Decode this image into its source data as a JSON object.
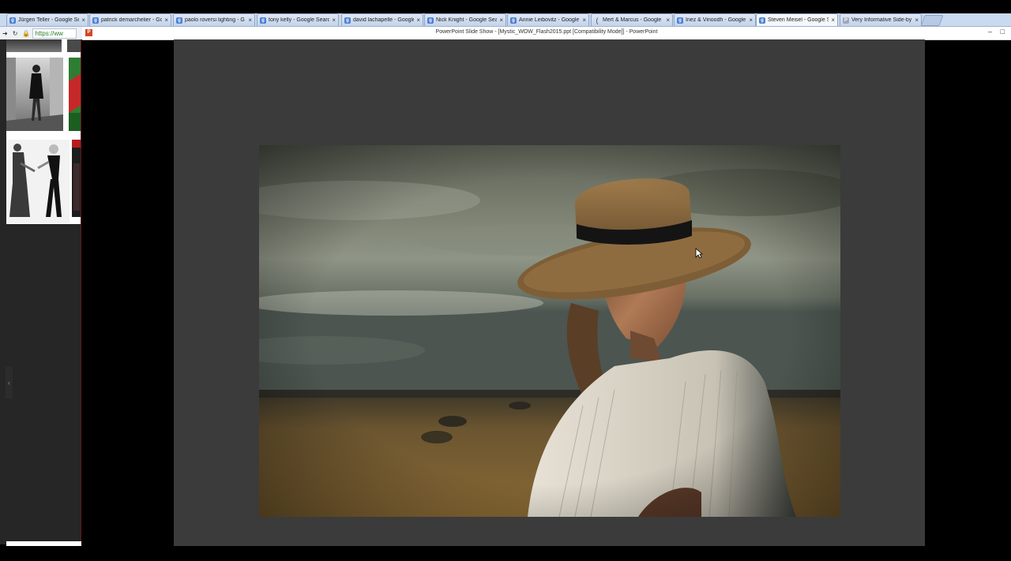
{
  "browser": {
    "tabs": [
      {
        "title": "Jürgen Teller - Google Se",
        "icon": "google-icon"
      },
      {
        "title": "patrick demarchelier - Go",
        "icon": "google-icon"
      },
      {
        "title": "paolo roversi lighting - G",
        "icon": "google-icon"
      },
      {
        "title": "tony kelly - Google Searc",
        "icon": "google-icon"
      },
      {
        "title": "david lachapelle - Google",
        "icon": "google-icon"
      },
      {
        "title": "Nick Knight - Google Sea",
        "icon": "google-icon"
      },
      {
        "title": "Annie Leibovitz - Google",
        "icon": "google-icon"
      },
      {
        "title": "Mert & Marcus - Google",
        "icon": "loading-icon"
      },
      {
        "title": "Inez & Vinoodh - Google",
        "icon": "google-icon"
      },
      {
        "title": "Steven Meisel - Google Se",
        "icon": "google-icon",
        "active": true
      },
      {
        "title": "Very Informative Side-by",
        "icon": "pp-icon"
      }
    ],
    "tab_close_glyph": "×",
    "url_text": "https://ww"
  },
  "powerpoint": {
    "window_title": "PowerPoint Slide Show - [Mystic_WOW_Flash2015.ppt [Compatibility Mode]] - PowerPoint",
    "app_icon_letter": "P",
    "minimize_glyph": "–",
    "maximize_glyph": "□"
  },
  "colors": {
    "slide_background": "#3b3b3b",
    "tab_active": "#f4f7fb",
    "tab_inactive": "#c3d3ea"
  }
}
